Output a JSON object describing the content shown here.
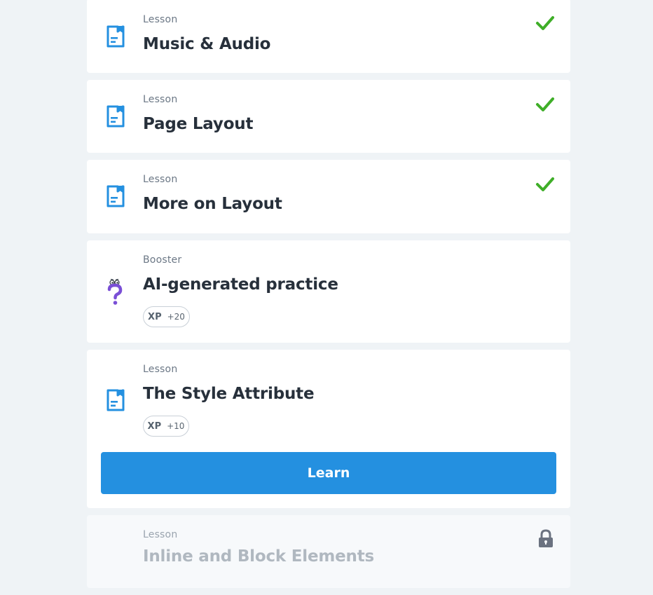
{
  "lessons": [
    {
      "type": "Lesson",
      "title": "Music & Audio",
      "status": "completed",
      "icon": "lesson-icon"
    },
    {
      "type": "Lesson",
      "title": "Page Layout",
      "status": "completed",
      "icon": "lesson-icon"
    },
    {
      "type": "Lesson",
      "title": "More on Layout",
      "status": "completed",
      "icon": "lesson-icon"
    },
    {
      "type": "Booster",
      "title": "AI-generated practice",
      "status": "available",
      "icon": "booster-question-icon",
      "xp_label": "XP",
      "xp_value": "+20"
    },
    {
      "type": "Lesson",
      "title": "The Style Attribute",
      "status": "current",
      "icon": "lesson-icon",
      "xp_label": "XP",
      "xp_value": "+10",
      "action_label": "Learn"
    },
    {
      "type": "Lesson",
      "title": "Inline and Block Elements",
      "status": "locked",
      "icon": "lesson-icon"
    }
  ],
  "colors": {
    "accent": "#2490e0",
    "check": "#3fae28",
    "booster": "#7a4fd6",
    "lock": "#6b7280"
  }
}
